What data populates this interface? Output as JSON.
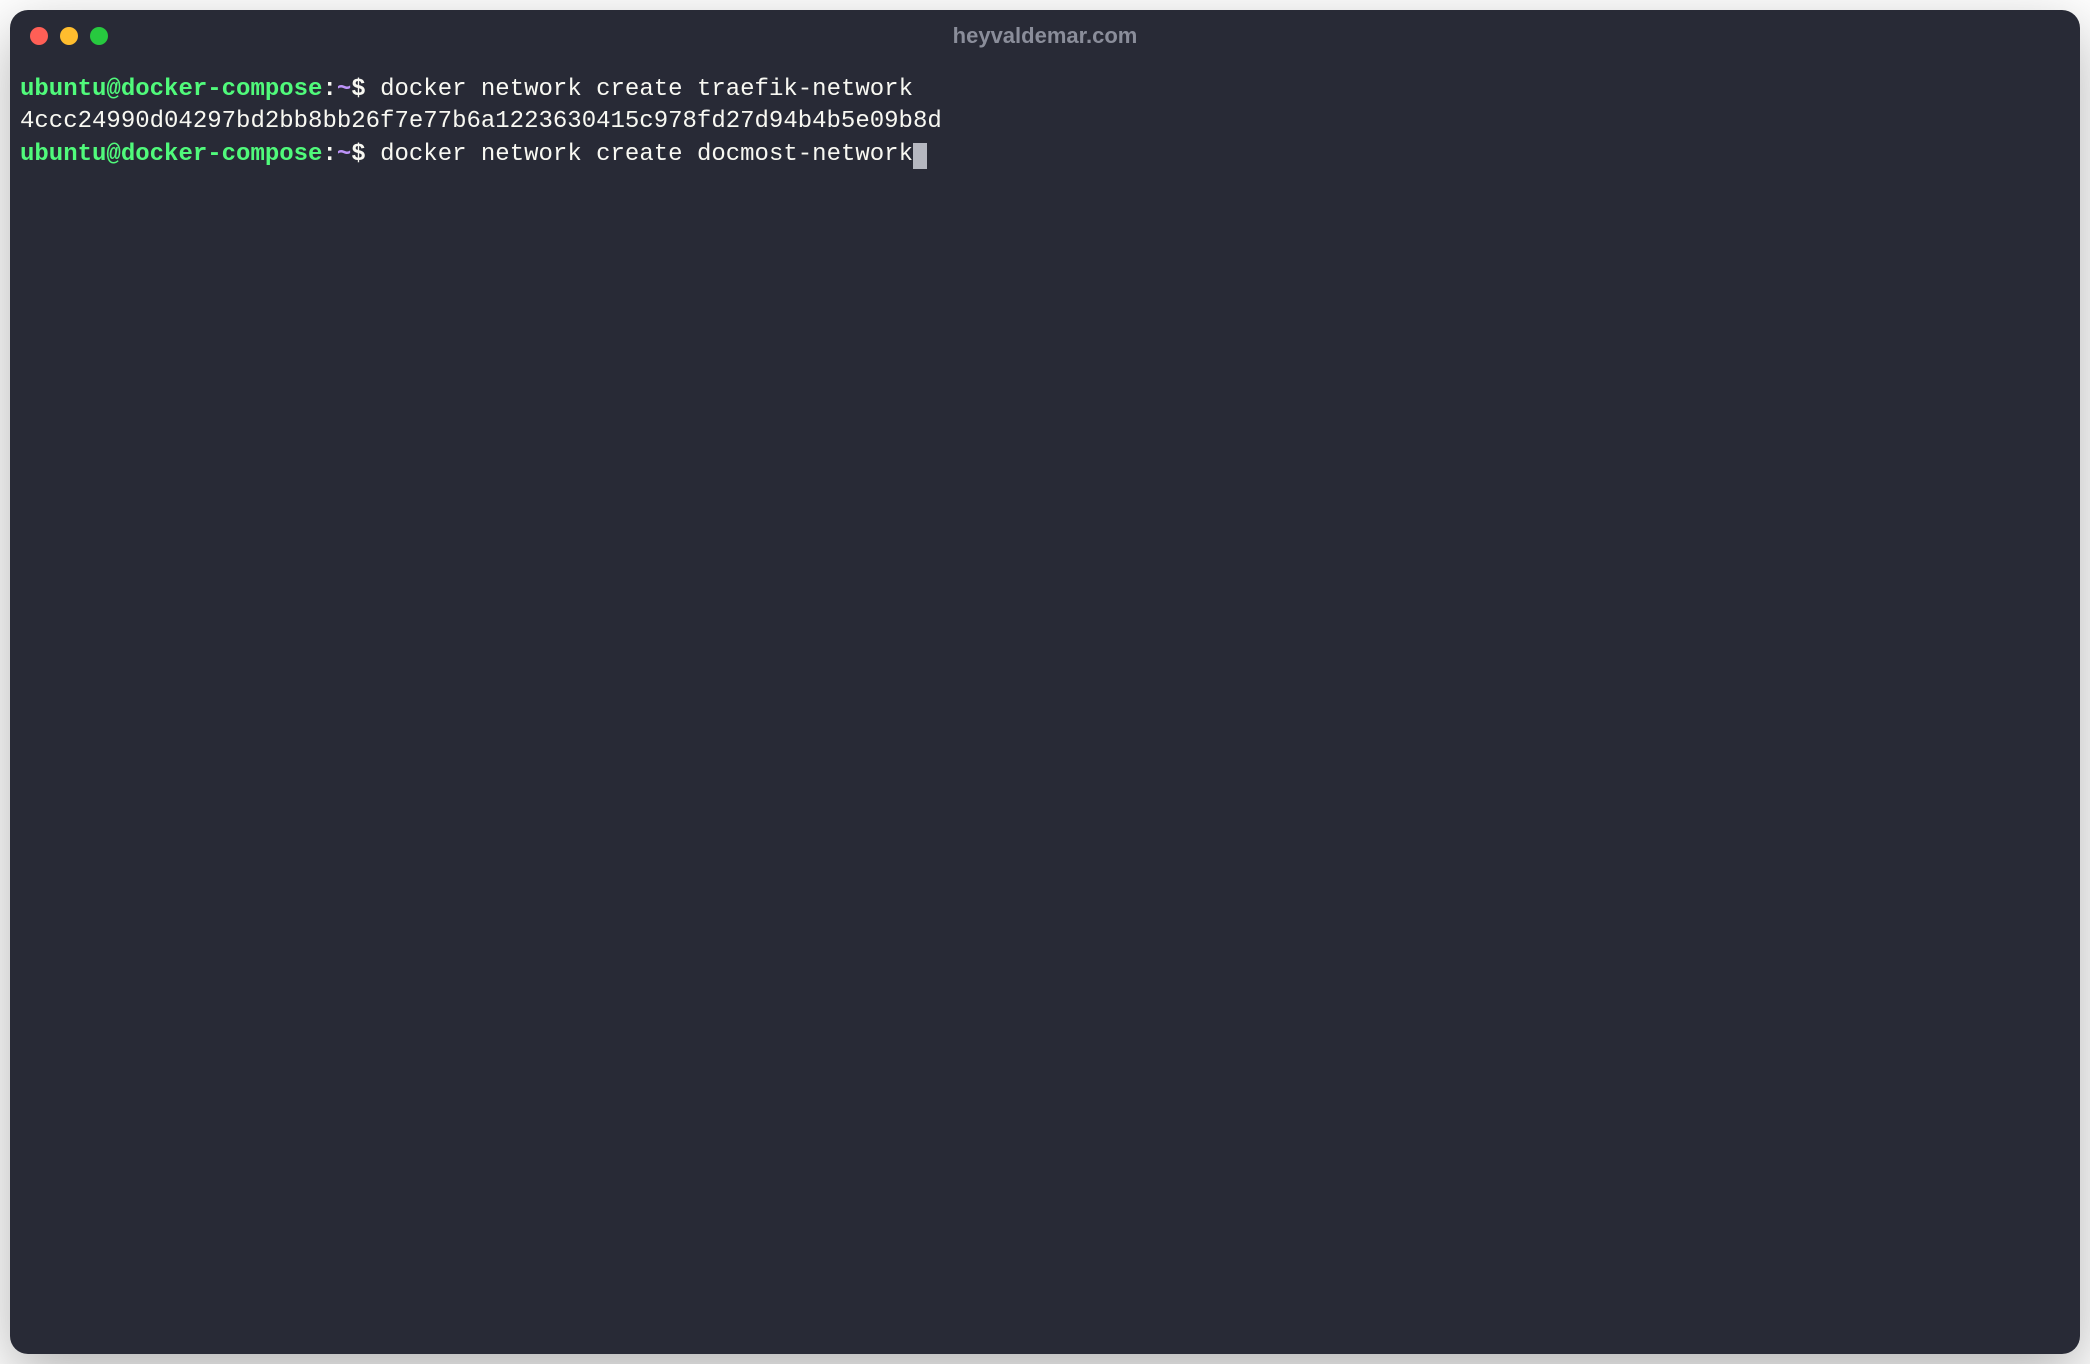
{
  "window": {
    "title": "heyvaldemar.com"
  },
  "prompt": {
    "user": "ubuntu",
    "at": "@",
    "host": "docker-compose",
    "colon": ":",
    "path": "~",
    "dollar": "$"
  },
  "lines": {
    "cmd1": " docker network create traefik-network",
    "out1": "4ccc24990d04297bd2bb8bb26f7e77b6a1223630415c978fd27d94b4b5e09b8d",
    "cmd2": " docker network create docmost-network"
  },
  "colors": {
    "background": "#282a36",
    "prompt_user": "#50fa7b",
    "prompt_path": "#bd93f9",
    "text": "#f8f8f2",
    "title": "#8a8d9a"
  }
}
